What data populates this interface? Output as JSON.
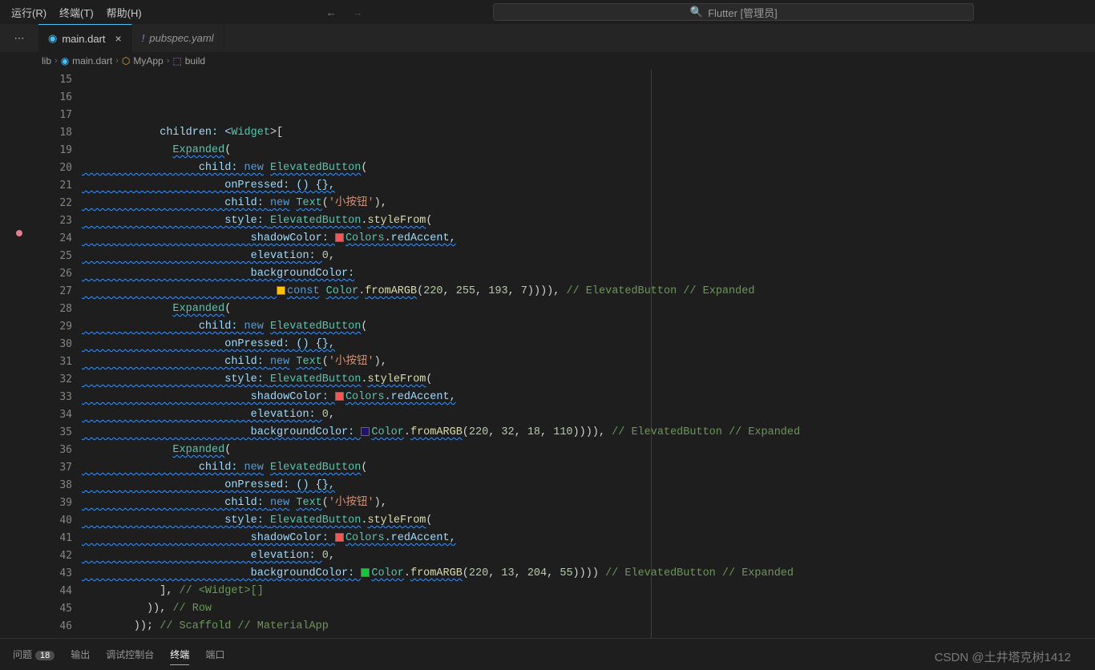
{
  "menu": {
    "run": "运行(R)",
    "terminal": "终端(T)",
    "help": "帮助(H)"
  },
  "search": {
    "icon": "🔍",
    "text": "Flutter [管理员]"
  },
  "tabs": {
    "main": {
      "icon": "◉",
      "label": "main.dart",
      "close": "×"
    },
    "pubspec": {
      "icon": "!",
      "label": "pubspec.yaml"
    }
  },
  "breadcrumb": {
    "b1": "lib",
    "b2": "main.dart",
    "b3": "MyApp",
    "b4": "build",
    "sep": "›"
  },
  "gutter_start": 15,
  "gutter_end": 46,
  "panel": {
    "problems": "问题",
    "problems_count": "18",
    "output": "输出",
    "debug": "调试控制台",
    "terminal": "终端",
    "ports": "端口"
  },
  "watermark": "CSDN @土井塔克树1412",
  "colors": {
    "red": "#ff5252",
    "yellow": "#ffc107",
    "purple": "#201272",
    "green": "#0dcc37"
  },
  "code": {
    "l15": {
      "a": "            children: <",
      "b": "Widget",
      "c": ">["
    },
    "l16": {
      "a": "              ",
      "b": "Expanded",
      "c": "("
    },
    "l17": {
      "a": "                  child: ",
      "b": "new",
      "c": " ",
      "d": "ElevatedButton",
      "e": "("
    },
    "l18": {
      "a": "                      onPressed: () {},"
    },
    "l19": {
      "a": "                      child: ",
      "b": "new",
      "c": " ",
      "d": "Text",
      "e": "(",
      "f": "'小按钮'",
      "g": "),"
    },
    "l20": {
      "a": "                      style: ",
      "b": "ElevatedButton",
      "c": ".",
      "d": "styleFrom",
      "e": "("
    },
    "l21": {
      "a": "                          shadowColor: ",
      "sw": "sw-red",
      "b": "Colors",
      "c": ".redAccent,"
    },
    "l22": {
      "a": "                          elevation: ",
      "b": "0",
      "c": ","
    },
    "l23": {
      "a": "                          backgroundColor:"
    },
    "l24": {
      "a": "                              ",
      "sw": "sw-yellow",
      "b": "const",
      "c": " ",
      "d": "Color",
      "e": ".",
      "f": "fromARGB",
      "g": "(",
      "h": "220",
      "i": ", ",
      "j": "255",
      "k": ", ",
      "l": "193",
      "m": ", ",
      "n": "7",
      "o": ")))), ",
      "p": "// ElevatedButton // Expanded"
    },
    "l25": {
      "a": "              ",
      "b": "Expanded",
      "c": "("
    },
    "l26": {
      "a": "                  child: ",
      "b": "new",
      "c": " ",
      "d": "ElevatedButton",
      "e": "("
    },
    "l27": {
      "a": "                      onPressed: () {},"
    },
    "l28": {
      "a": "                      child: ",
      "b": "new",
      "c": " ",
      "d": "Text",
      "e": "(",
      "f": "'小按钮'",
      "g": "),"
    },
    "l29": {
      "a": "                      style: ",
      "b": "ElevatedButton",
      "c": ".",
      "d": "styleFrom",
      "e": "("
    },
    "l30": {
      "a": "                          shadowColor: ",
      "sw": "sw-red",
      "b": "Colors",
      "c": ".redAccent,"
    },
    "l31": {
      "a": "                          elevation: ",
      "b": "0",
      "c": ","
    },
    "l32": {
      "a": "                          backgroundColor: ",
      "sw": "sw-purple",
      "b": "Color",
      "c": ".",
      "d": "fromARGB",
      "e": "(",
      "f": "220",
      "g": ", ",
      "h": "32",
      "i": ", ",
      "j": "18",
      "k": ", ",
      "l": "110",
      "m": ")))), ",
      "n": "// ElevatedButton // Expanded"
    },
    "l33": {
      "a": "              ",
      "b": "Expanded",
      "c": "("
    },
    "l34": {
      "a": "                  child: ",
      "b": "new",
      "c": " ",
      "d": "ElevatedButton",
      "e": "("
    },
    "l35": {
      "a": "                      onPressed: () {},"
    },
    "l36": {
      "a": "                      child: ",
      "b": "new",
      "c": " ",
      "d": "Text",
      "e": "(",
      "f": "'小按钮'",
      "g": "),"
    },
    "l37": {
      "a": "                      style: ",
      "b": "ElevatedButton",
      "c": ".",
      "d": "styleFrom",
      "e": "("
    },
    "l38": {
      "a": "                          shadowColor: ",
      "sw": "sw-red",
      "b": "Colors",
      "c": ".redAccent,"
    },
    "l39": {
      "a": "                          elevation: ",
      "b": "0",
      "c": ","
    },
    "l40": {
      "a": "                          backgroundColor: ",
      "sw": "sw-green",
      "b": "Color",
      "c": ".",
      "d": "fromARGB",
      "e": "(",
      "f": "220",
      "g": ", ",
      "h": "13",
      "i": ", ",
      "j": "204",
      "k": ", ",
      "l": "55",
      "m": ")))) ",
      "n": "// ElevatedButton // Expanded"
    },
    "l41": {
      "a": "            ], ",
      "b": "// <Widget>[]"
    },
    "l42": {
      "a": "          )), ",
      "b": "// Row"
    },
    "l43": {
      "a": "        )); ",
      "b": "// Scaffold // MaterialApp"
    },
    "l44": {
      "a": "  }"
    },
    "l45": {
      "a": "}"
    },
    "l46": {
      "a": ""
    }
  }
}
